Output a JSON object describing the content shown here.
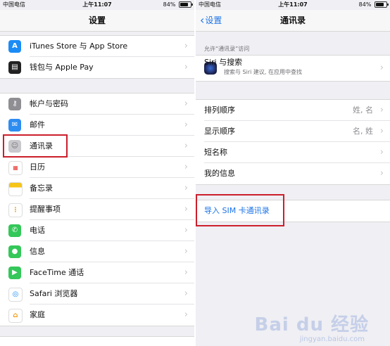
{
  "left": {
    "status": {
      "carrier": "中国电信",
      "time": "上午11:07",
      "battery": "84%"
    },
    "title": "设置",
    "group1": [
      {
        "label": "iTunes Store 与 App Store",
        "icon": "app-store-icon",
        "color": "#1b8cf5"
      },
      {
        "label": "钱包与 Apple Pay",
        "icon": "wallet-icon",
        "color": "#222222"
      }
    ],
    "group2": [
      {
        "label": "帐户与密码",
        "icon": "key-icon",
        "color": "#8e8e93"
      },
      {
        "label": "邮件",
        "icon": "mail-icon",
        "color": "#2d8cf0"
      },
      {
        "label": "通讯录",
        "icon": "contacts-icon",
        "color": "#b8b8bd"
      },
      {
        "label": "日历",
        "icon": "calendar-icon",
        "color": "#ffffff"
      },
      {
        "label": "备忘录",
        "icon": "notes-icon",
        "color": "#f5c518"
      },
      {
        "label": "提醒事项",
        "icon": "reminders-icon",
        "color": "#ffffff"
      },
      {
        "label": "电话",
        "icon": "phone-icon",
        "color": "#34c759"
      },
      {
        "label": "信息",
        "icon": "messages-icon",
        "color": "#34c759"
      },
      {
        "label": "FaceTime 通话",
        "icon": "facetime-icon",
        "color": "#34c759"
      },
      {
        "label": "Safari 浏览器",
        "icon": "safari-icon",
        "color": "#1a8cf0"
      },
      {
        "label": "家庭",
        "icon": "home-icon",
        "color": "#ffffff"
      }
    ]
  },
  "right": {
    "status": {
      "carrier": "中国电信",
      "time": "上午11:07",
      "battery": "84%"
    },
    "back_label": "设置",
    "title": "通讯录",
    "allow_header": "允许“通讯录”访问",
    "siri": {
      "title": "Siri 与搜索",
      "subtitle": "搜索与 Siri 建议, 在应用中查找"
    },
    "prefs": [
      {
        "label": "排列顺序",
        "value": "姓, 名"
      },
      {
        "label": "显示顺序",
        "value": "名, 姓"
      },
      {
        "label": "短名称",
        "value": ""
      },
      {
        "label": "我的信息",
        "value": ""
      }
    ],
    "import_sim": "导入 SIM 卡通讯录"
  },
  "watermark": {
    "brand": "Bai du 经验",
    "sub": "jingyan.baidu.com"
  },
  "highlight_color": "#cc1f2c"
}
